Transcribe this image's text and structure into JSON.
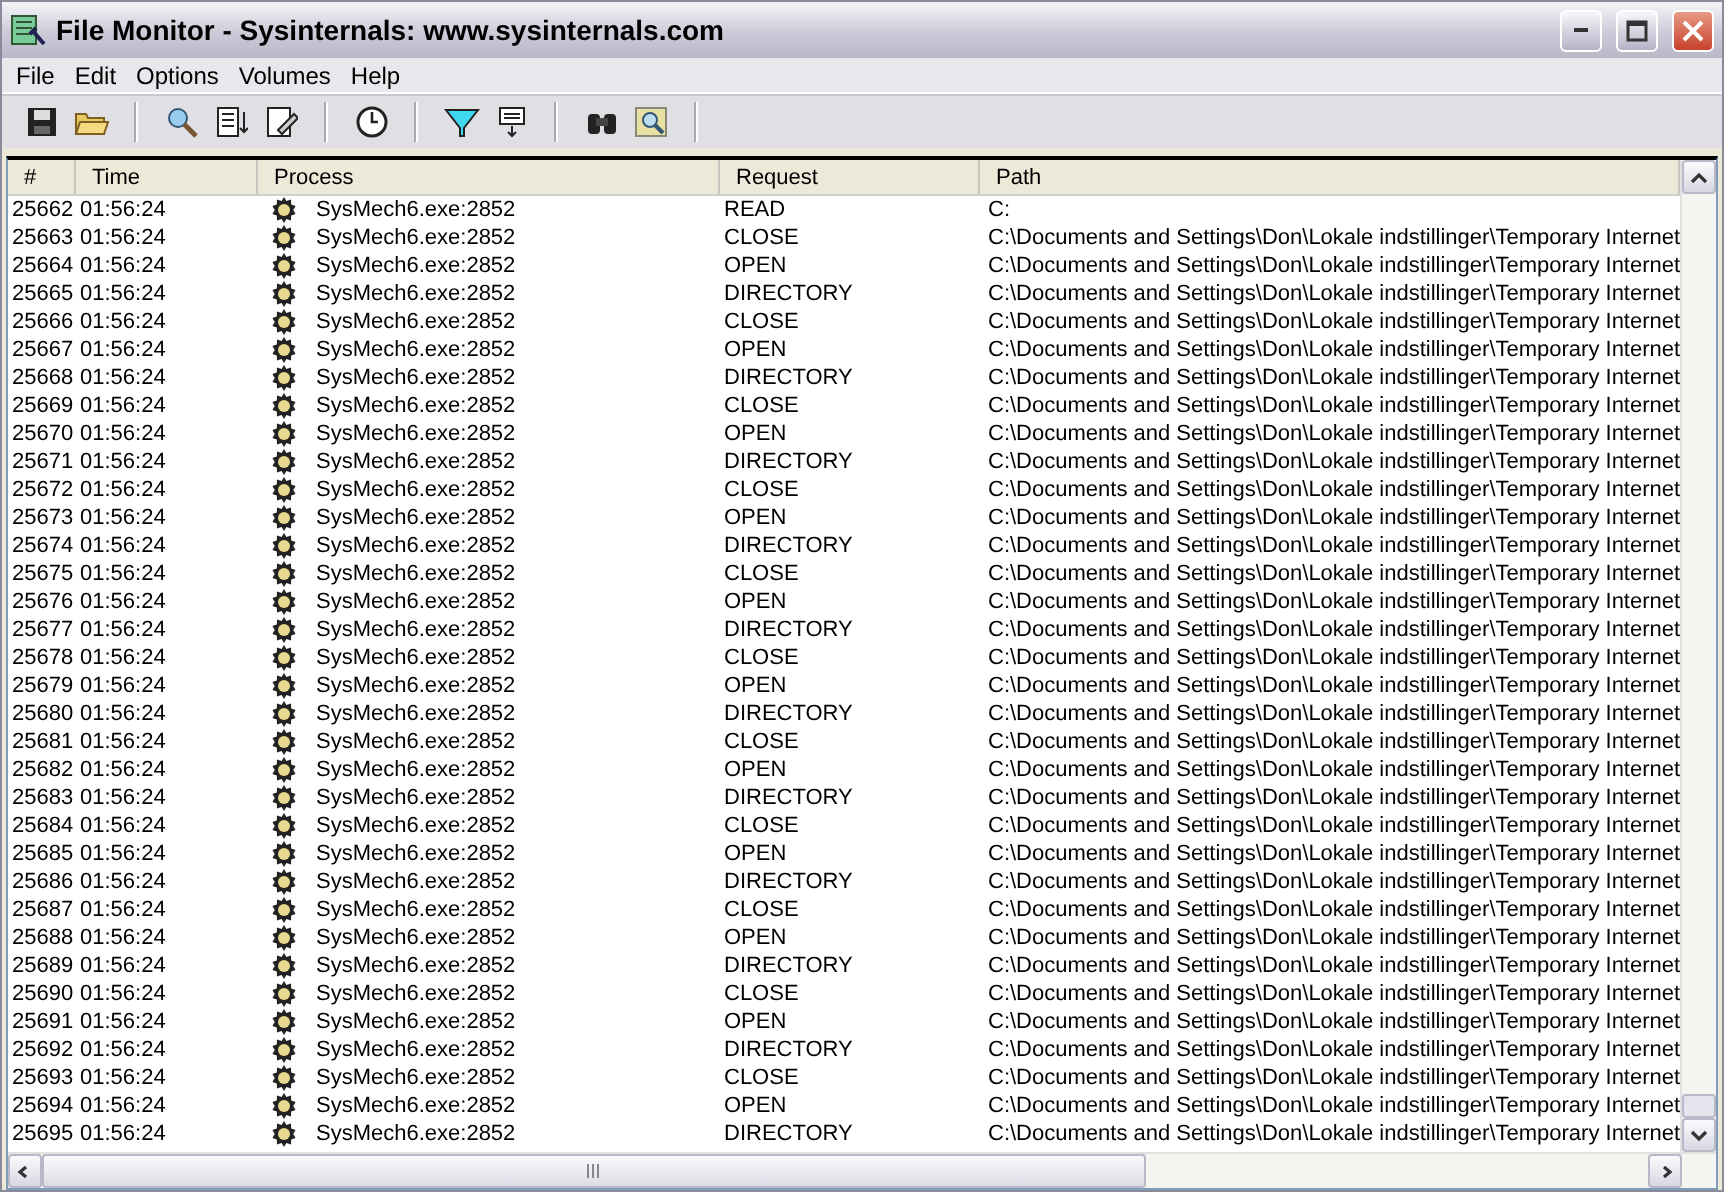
{
  "window": {
    "title": "File Monitor - Sysinternals: www.sysinternals.com"
  },
  "menu": [
    "File",
    "Edit",
    "Options",
    "Volumes",
    "Help"
  ],
  "toolbar": [
    {
      "kind": "save"
    },
    {
      "kind": "open"
    },
    {
      "kind": "sep"
    },
    {
      "kind": "capture"
    },
    {
      "kind": "autoscroll"
    },
    {
      "kind": "clear"
    },
    {
      "kind": "sep"
    },
    {
      "kind": "clock"
    },
    {
      "kind": "sep"
    },
    {
      "kind": "filter"
    },
    {
      "kind": "highlight"
    },
    {
      "kind": "sep"
    },
    {
      "kind": "find"
    },
    {
      "kind": "jump"
    },
    {
      "kind": "sep"
    }
  ],
  "table": {
    "columns": [
      "#",
      "Time",
      "Process",
      "Request",
      "Path"
    ],
    "rows": [
      [
        "25662",
        "01:56:24",
        "SysMech6.exe:2852",
        "READ",
        "C:"
      ],
      [
        "25663",
        "01:56:24",
        "SysMech6.exe:2852",
        "CLOSE",
        "C:\\Documents and Settings\\Don\\Lokale indstillinger\\Temporary Internet"
      ],
      [
        "25664",
        "01:56:24",
        "SysMech6.exe:2852",
        "OPEN",
        "C:\\Documents and Settings\\Don\\Lokale indstillinger\\Temporary Internet"
      ],
      [
        "25665",
        "01:56:24",
        "SysMech6.exe:2852",
        "DIRECTORY",
        "C:\\Documents and Settings\\Don\\Lokale indstillinger\\Temporary Internet"
      ],
      [
        "25666",
        "01:56:24",
        "SysMech6.exe:2852",
        "CLOSE",
        "C:\\Documents and Settings\\Don\\Lokale indstillinger\\Temporary Internet"
      ],
      [
        "25667",
        "01:56:24",
        "SysMech6.exe:2852",
        "OPEN",
        "C:\\Documents and Settings\\Don\\Lokale indstillinger\\Temporary Internet"
      ],
      [
        "25668",
        "01:56:24",
        "SysMech6.exe:2852",
        "DIRECTORY",
        "C:\\Documents and Settings\\Don\\Lokale indstillinger\\Temporary Internet"
      ],
      [
        "25669",
        "01:56:24",
        "SysMech6.exe:2852",
        "CLOSE",
        "C:\\Documents and Settings\\Don\\Lokale indstillinger\\Temporary Internet"
      ],
      [
        "25670",
        "01:56:24",
        "SysMech6.exe:2852",
        "OPEN",
        "C:\\Documents and Settings\\Don\\Lokale indstillinger\\Temporary Internet"
      ],
      [
        "25671",
        "01:56:24",
        "SysMech6.exe:2852",
        "DIRECTORY",
        "C:\\Documents and Settings\\Don\\Lokale indstillinger\\Temporary Internet"
      ],
      [
        "25672",
        "01:56:24",
        "SysMech6.exe:2852",
        "CLOSE",
        "C:\\Documents and Settings\\Don\\Lokale indstillinger\\Temporary Internet"
      ],
      [
        "25673",
        "01:56:24",
        "SysMech6.exe:2852",
        "OPEN",
        "C:\\Documents and Settings\\Don\\Lokale indstillinger\\Temporary Internet"
      ],
      [
        "25674",
        "01:56:24",
        "SysMech6.exe:2852",
        "DIRECTORY",
        "C:\\Documents and Settings\\Don\\Lokale indstillinger\\Temporary Internet"
      ],
      [
        "25675",
        "01:56:24",
        "SysMech6.exe:2852",
        "CLOSE",
        "C:\\Documents and Settings\\Don\\Lokale indstillinger\\Temporary Internet"
      ],
      [
        "25676",
        "01:56:24",
        "SysMech6.exe:2852",
        "OPEN",
        "C:\\Documents and Settings\\Don\\Lokale indstillinger\\Temporary Internet"
      ],
      [
        "25677",
        "01:56:24",
        "SysMech6.exe:2852",
        "DIRECTORY",
        "C:\\Documents and Settings\\Don\\Lokale indstillinger\\Temporary Internet"
      ],
      [
        "25678",
        "01:56:24",
        "SysMech6.exe:2852",
        "CLOSE",
        "C:\\Documents and Settings\\Don\\Lokale indstillinger\\Temporary Internet"
      ],
      [
        "25679",
        "01:56:24",
        "SysMech6.exe:2852",
        "OPEN",
        "C:\\Documents and Settings\\Don\\Lokale indstillinger\\Temporary Internet"
      ],
      [
        "25680",
        "01:56:24",
        "SysMech6.exe:2852",
        "DIRECTORY",
        "C:\\Documents and Settings\\Don\\Lokale indstillinger\\Temporary Internet"
      ],
      [
        "25681",
        "01:56:24",
        "SysMech6.exe:2852",
        "CLOSE",
        "C:\\Documents and Settings\\Don\\Lokale indstillinger\\Temporary Internet"
      ],
      [
        "25682",
        "01:56:24",
        "SysMech6.exe:2852",
        "OPEN",
        "C:\\Documents and Settings\\Don\\Lokale indstillinger\\Temporary Internet"
      ],
      [
        "25683",
        "01:56:24",
        "SysMech6.exe:2852",
        "DIRECTORY",
        "C:\\Documents and Settings\\Don\\Lokale indstillinger\\Temporary Internet"
      ],
      [
        "25684",
        "01:56:24",
        "SysMech6.exe:2852",
        "CLOSE",
        "C:\\Documents and Settings\\Don\\Lokale indstillinger\\Temporary Internet"
      ],
      [
        "25685",
        "01:56:24",
        "SysMech6.exe:2852",
        "OPEN",
        "C:\\Documents and Settings\\Don\\Lokale indstillinger\\Temporary Internet"
      ],
      [
        "25686",
        "01:56:24",
        "SysMech6.exe:2852",
        "DIRECTORY",
        "C:\\Documents and Settings\\Don\\Lokale indstillinger\\Temporary Internet"
      ],
      [
        "25687",
        "01:56:24",
        "SysMech6.exe:2852",
        "CLOSE",
        "C:\\Documents and Settings\\Don\\Lokale indstillinger\\Temporary Internet"
      ],
      [
        "25688",
        "01:56:24",
        "SysMech6.exe:2852",
        "OPEN",
        "C:\\Documents and Settings\\Don\\Lokale indstillinger\\Temporary Internet"
      ],
      [
        "25689",
        "01:56:24",
        "SysMech6.exe:2852",
        "DIRECTORY",
        "C:\\Documents and Settings\\Don\\Lokale indstillinger\\Temporary Internet"
      ],
      [
        "25690",
        "01:56:24",
        "SysMech6.exe:2852",
        "CLOSE",
        "C:\\Documents and Settings\\Don\\Lokale indstillinger\\Temporary Internet"
      ],
      [
        "25691",
        "01:56:24",
        "SysMech6.exe:2852",
        "OPEN",
        "C:\\Documents and Settings\\Don\\Lokale indstillinger\\Temporary Internet"
      ],
      [
        "25692",
        "01:56:24",
        "SysMech6.exe:2852",
        "DIRECTORY",
        "C:\\Documents and Settings\\Don\\Lokale indstillinger\\Temporary Internet"
      ],
      [
        "25693",
        "01:56:24",
        "SysMech6.exe:2852",
        "CLOSE",
        "C:\\Documents and Settings\\Don\\Lokale indstillinger\\Temporary Internet"
      ],
      [
        "25694",
        "01:56:24",
        "SysMech6.exe:2852",
        "OPEN",
        "C:\\Documents and Settings\\Don\\Lokale indstillinger\\Temporary Internet"
      ],
      [
        "25695",
        "01:56:24",
        "SysMech6.exe:2852",
        "DIRECTORY",
        "C:\\Documents and Settings\\Don\\Lokale indstillinger\\Temporary Internet"
      ]
    ]
  }
}
